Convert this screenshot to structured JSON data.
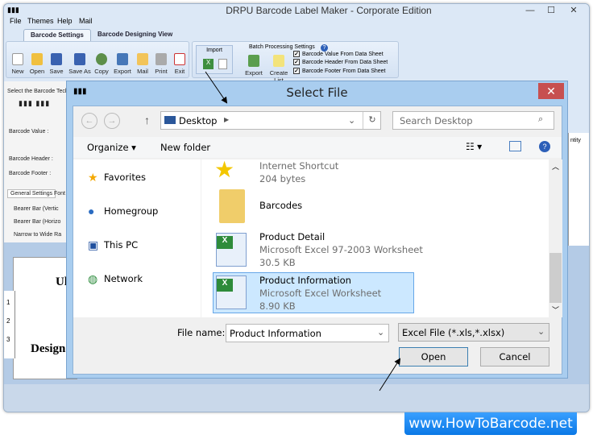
{
  "app": {
    "title": "DRPU Barcode Label Maker - Corporate Edition"
  },
  "menu": [
    "File",
    "Themes",
    "Help",
    "Mail"
  ],
  "tabs": [
    {
      "label": "Barcode Settings",
      "selected": true
    },
    {
      "label": "Barcode Designing View",
      "selected": false
    }
  ],
  "toolbar": [
    "New",
    "Open",
    "Save",
    "Save As",
    "Copy",
    "Export",
    "Mail",
    "Print",
    "Exit"
  ],
  "batch": {
    "title": "Batch Processing Settings",
    "import_label": "Import",
    "export_label": "Export",
    "create_list_label": "Create List",
    "checks": [
      {
        "label": "Barcode Value From Data Sheet",
        "checked": true
      },
      {
        "label": "Barcode Header From Data Sheet",
        "checked": true
      },
      {
        "label": "Barcode Footer From Data Sheet",
        "checked": true
      }
    ]
  },
  "left_panel": {
    "tech_label": "Select the Barcode Techn",
    "value_label": "Barcode Value :",
    "header_label": "Barcode Header :",
    "footer_label": "Barcode Footer :",
    "tabs": [
      "General Settings",
      "Font"
    ],
    "settings": [
      "Bearer Bar (Vertic",
      "Bearer Bar (Horizo",
      "Narrow to Wide Ra"
    ]
  },
  "canvas": {
    "text1": "Ul",
    "text2": "Design",
    "ruler": [
      "1",
      "2",
      "3"
    ]
  },
  "grid_header": "ntity",
  "dialog": {
    "title": "Select File",
    "address": "Desktop",
    "search_placeholder": "Search Desktop",
    "organize": "Organize",
    "new_folder": "New folder",
    "nav": [
      "Favorites",
      "Homegroup",
      "This PC",
      "Network"
    ],
    "files": [
      {
        "name": "Internet Shortcut",
        "type": "",
        "size": "204 bytes"
      },
      {
        "name": "Barcodes",
        "type": "",
        "size": ""
      },
      {
        "name": "Product Detail",
        "type": "Microsoft Excel 97-2003 Worksheet",
        "size": "30.5 KB"
      },
      {
        "name": "Product Information",
        "type": "Microsoft Excel Worksheet",
        "size": "8.90 KB",
        "selected": true
      }
    ],
    "filename_label": "File name:",
    "filename_value": "Product Information",
    "filter": "Excel File (*.xls,*.xlsx)",
    "open": "Open",
    "cancel": "Cancel"
  },
  "watermark": "www.HowToBarcode.net",
  "colors": {
    "close": "#c75050",
    "selection": "#cce8ff",
    "watermark": "#1a8cf0"
  }
}
